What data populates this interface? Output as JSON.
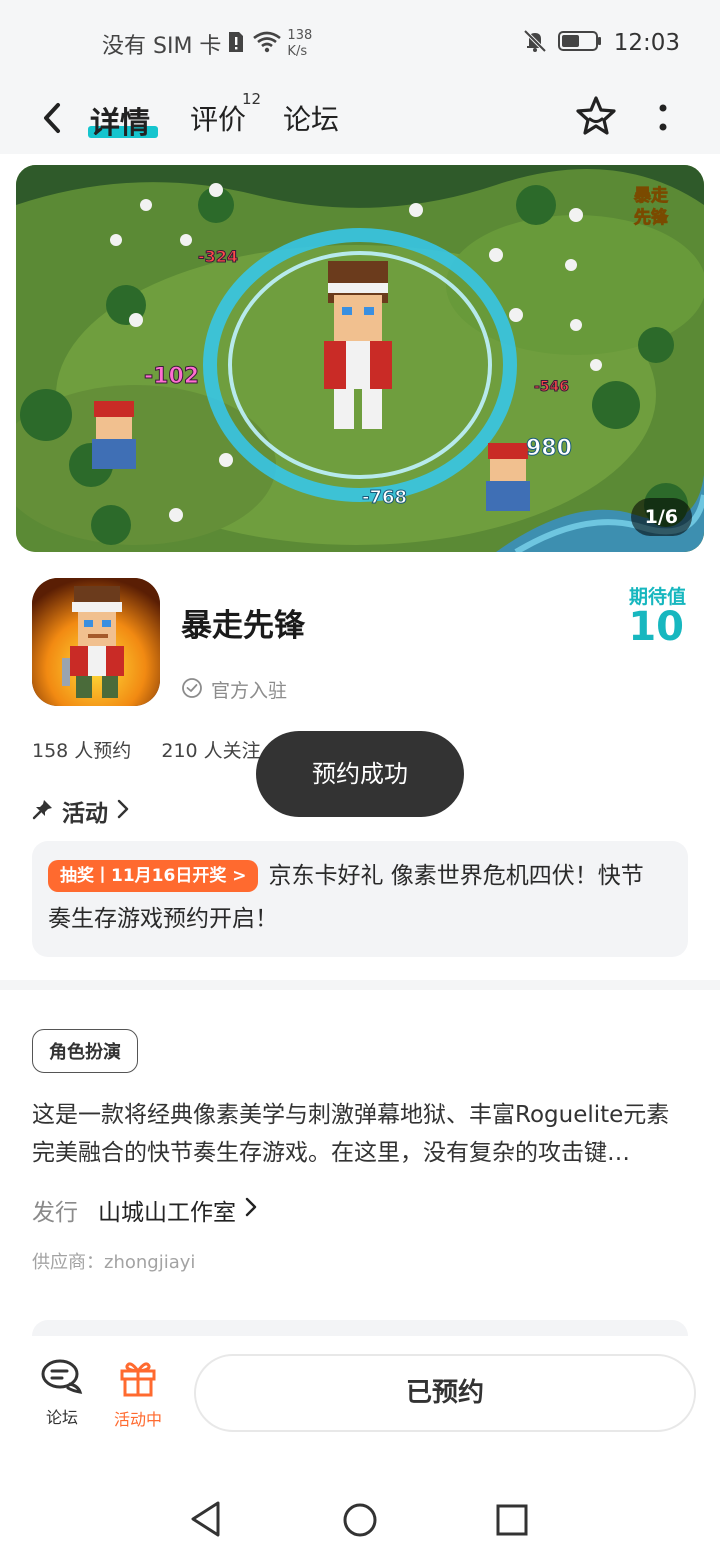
{
  "status_bar": {
    "carrier": "没有 SIM 卡",
    "speed_value": "138",
    "speed_unit": "K/s",
    "time": "12:03"
  },
  "header": {
    "tabs": [
      {
        "label": "详情"
      },
      {
        "label": "评价",
        "count": "12"
      },
      {
        "label": "论坛"
      }
    ]
  },
  "banner": {
    "counter": "1/6",
    "damage_numbers": [
      "-324",
      "-102",
      "-546",
      "980",
      "-768"
    ],
    "logo_text": [
      "暴走",
      "先锋"
    ]
  },
  "app": {
    "name": "暴走先锋",
    "official": "官方入驻",
    "expect_label": "期待值",
    "expect_value": "10"
  },
  "stats": {
    "reservations": "158 人预约",
    "followers": "210 人关注"
  },
  "activity": {
    "label": "活动",
    "promo_badge": "抽奖丨11月16日开奖 >",
    "promo_text": "京东卡好礼 像素世界危机四伏！快节奏生存游戏预约开启！"
  },
  "details": {
    "genre": "角色扮演",
    "description": "这是一款将经典像素美学与刺激弹幕地狱、丰富Roguelite元素完美融合的快节奏生存游戏。在这里，没有复杂的攻击键…",
    "publisher_label": "发行",
    "publisher_name": "山城山工作室",
    "supplier": "供应商：zhongjiayi"
  },
  "toast": "预约成功",
  "bottom_bar": {
    "forum_label": "论坛",
    "activity_label": "活动中",
    "reserved_label": "已预约"
  },
  "colors": {
    "accent": "#15c5ce",
    "expect": "#17b7bf",
    "promo_orange": "#ff6a2f"
  }
}
